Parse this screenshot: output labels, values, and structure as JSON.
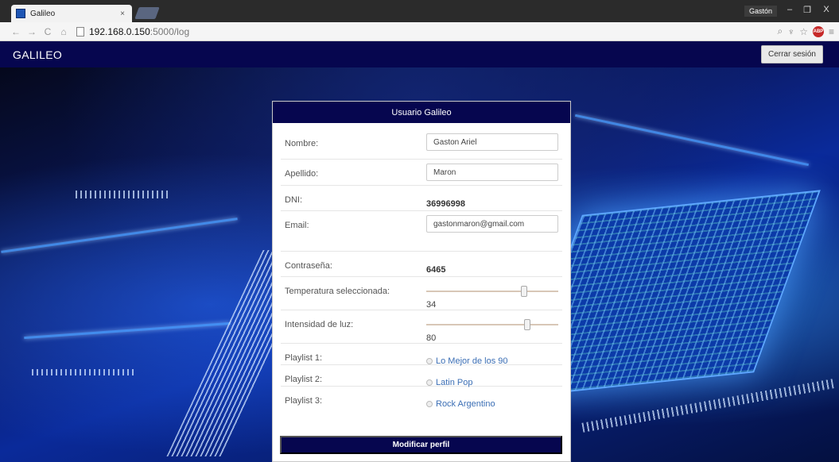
{
  "browser": {
    "tab_title": "Galileo",
    "tab_close": "×",
    "user_name": "Gastón",
    "url_host": "192.168.0.150",
    "url_path": ":5000/log",
    "nav_back": "←",
    "nav_forward": "→",
    "nav_reload": "C",
    "nav_home": "⌂",
    "win_min": "–",
    "win_max": "❐",
    "win_close": "X",
    "abp_label": "ABP"
  },
  "header": {
    "brand": "GALILEO",
    "logout_label": "Cerrar sesión"
  },
  "card": {
    "title": "Usuario Galileo",
    "fields": {
      "nombre": {
        "label": "Nombre:",
        "value": "Gaston Ariel"
      },
      "apellido": {
        "label": "Apellido:",
        "value": "Maron"
      },
      "dni": {
        "label": "DNI:",
        "value": "36996998"
      },
      "email": {
        "label": "Email:",
        "value": "gastonmaron@gmail.com"
      },
      "contrasena": {
        "label": "Contraseña:",
        "value": "6465"
      },
      "temperatura": {
        "label": "Temperatura seleccionada:",
        "value": "34",
        "level": 0.75
      },
      "luz": {
        "label": "Intensidad de luz:",
        "value": "80",
        "level": 0.78
      },
      "playlist1": {
        "label": "Playlist 1:",
        "value": "Lo Mejor de los 90"
      },
      "playlist2": {
        "label": "Playlist 2:",
        "value": "Latin Pop"
      },
      "playlist3": {
        "label": "Playlist 3:",
        "value": "Rock Argentino"
      }
    },
    "submit_label": "Modificar perfil"
  },
  "colors": {
    "header_bg": "#06064f",
    "link": "#3c6fb5"
  }
}
